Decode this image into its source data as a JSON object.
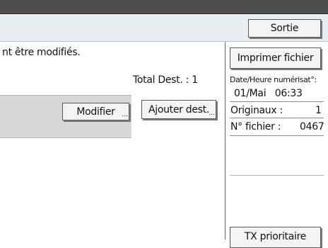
{
  "header": {
    "exit_label": "Sortie"
  },
  "message": "nt être modifiés.",
  "total_dest": "Total Dest. : 1",
  "buttons": {
    "modify": "Modifier",
    "add_dest": "Ajouter dest.",
    "ellipsis": "..."
  },
  "side": {
    "print_file": "Imprimer fichier",
    "date_label": "Date/Heure numérisat°:",
    "date_value": "01/Mai   06:33",
    "originals_label": "Originaux :",
    "originals_value": "1",
    "file_no_label": "N° fichier :",
    "file_no_value": "0467",
    "priority_tx": "TX prioritaire"
  }
}
